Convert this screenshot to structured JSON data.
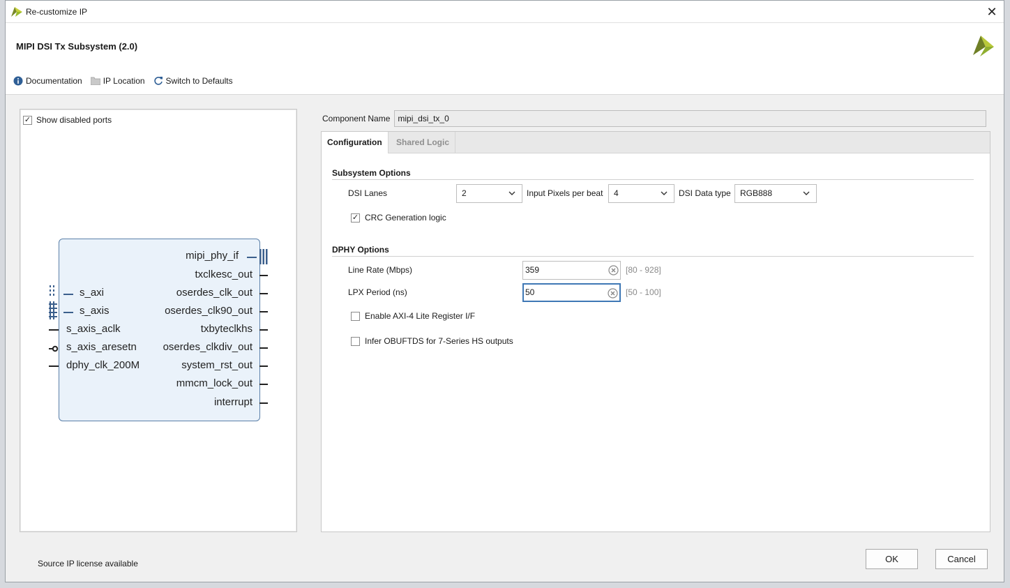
{
  "window": {
    "title": "Re-customize IP",
    "close": "✕"
  },
  "header": {
    "ip_title": "MIPI DSI Tx Subsystem (2.0)"
  },
  "toolbar": {
    "documentation": "Documentation",
    "ip_location": "IP Location",
    "switch_defaults": "Switch to Defaults"
  },
  "left": {
    "show_disabled_label": "Show disabled ports",
    "show_disabled_checked": "✓",
    "ports_right": [
      "mipi_phy_if",
      "txclkesc_out",
      "oserdes_clk_out",
      "oserdes_clk90_out",
      "txbyteclkhs",
      "oserdes_clkdiv_out",
      "system_rst_out",
      "mmcm_lock_out",
      "interrupt"
    ],
    "ports_left": [
      "s_axi",
      "s_axis",
      "s_axis_aclk",
      "s_axis_aresetn",
      "dphy_clk_200M"
    ]
  },
  "component": {
    "label": "Component Name",
    "value": "mipi_dsi_tx_0"
  },
  "tabs": {
    "configuration": "Configuration",
    "shared_logic": "Shared Logic"
  },
  "subsystem": {
    "heading": "Subsystem Options",
    "dsi_lanes_label": "DSI Lanes",
    "dsi_lanes_value": "2",
    "pixels_label": "Input Pixels per beat",
    "pixels_value": "4",
    "data_type_label": "DSI Data type",
    "data_type_value": "RGB888",
    "crc_label": "CRC Generation logic",
    "crc_checked": "✓"
  },
  "dphy": {
    "heading": "DPHY Options",
    "line_rate_label": "Line Rate (Mbps)",
    "line_rate_value": "359",
    "line_rate_range": "[80 - 928]",
    "lpx_label": "LPX Period (ns)",
    "lpx_value": "50",
    "lpx_range": "[50 - 100]",
    "axi_lite_label": "Enable AXI-4 Lite Register I/F",
    "obuftds_label": "Infer OBUFTDS for 7-Series HS outputs"
  },
  "footer": {
    "license": "Source IP license available",
    "ok": "OK",
    "cancel": "Cancel"
  },
  "colors": {
    "accent": "#3f78b5",
    "brand_yellow": "#9bbb2b",
    "block_fill": "#eaf2fa"
  }
}
